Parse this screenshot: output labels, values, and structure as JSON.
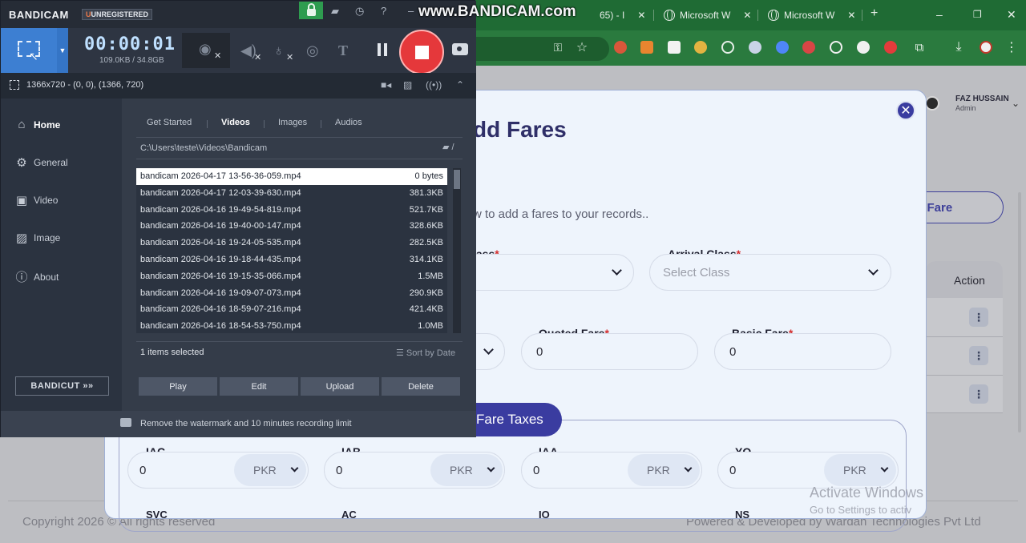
{
  "bandicam": {
    "brand": "BANDICAM",
    "unregistered": "UNREGISTERED",
    "watermark": "www.BANDICAM.com",
    "timer": "00:00:01",
    "sizes": "109.0KB / 34.8GB",
    "area": "1366x720 - (0, 0), (1366, 720)",
    "sidebar": [
      {
        "label": "Home",
        "icon": "home-icon",
        "active": true
      },
      {
        "label": "General",
        "icon": "gear-icon"
      },
      {
        "label": "Video",
        "icon": "video-icon"
      },
      {
        "label": "Image",
        "icon": "image-icon"
      },
      {
        "label": "About",
        "icon": "info-icon"
      }
    ],
    "bandicut": "BANDICUT",
    "tabs": [
      "Get Started",
      "Videos",
      "Images",
      "Audios"
    ],
    "active_tab": "Videos",
    "path": "C:\\Users\\teste\\Videos\\Bandicam",
    "files": [
      {
        "name": "bandicam 2026-04-17 13-56-36-059.mp4",
        "size": "0 bytes",
        "selected": true
      },
      {
        "name": "bandicam 2026-04-17 12-03-39-630.mp4",
        "size": "381.3KB"
      },
      {
        "name": "bandicam 2026-04-16 19-49-54-819.mp4",
        "size": "521.7KB"
      },
      {
        "name": "bandicam 2026-04-16 19-40-00-147.mp4",
        "size": "328.6KB"
      },
      {
        "name": "bandicam 2026-04-16 19-24-05-535.mp4",
        "size": "282.5KB"
      },
      {
        "name": "bandicam 2026-04-16 19-18-44-435.mp4",
        "size": "314.1KB"
      },
      {
        "name": "bandicam 2026-04-16 19-15-35-066.mp4",
        "size": "1.5MB"
      },
      {
        "name": "bandicam 2026-04-16 19-09-07-073.mp4",
        "size": "290.9KB"
      },
      {
        "name": "bandicam 2026-04-16 18-59-07-216.mp4",
        "size": "421.4KB"
      },
      {
        "name": "bandicam 2026-04-16 18-54-53-750.mp4",
        "size": "1.0MB"
      }
    ],
    "selection": "1 items selected",
    "sort": "Sort by Date",
    "actions": [
      "Play",
      "Edit",
      "Upload",
      "Delete"
    ],
    "footer": "Remove the watermark and 10 minutes recording limit"
  },
  "browser": {
    "tabs": [
      {
        "title": "65) - I"
      },
      {
        "title": "Microsoft W"
      },
      {
        "title": "Microsoft W"
      }
    ],
    "new_tab": "+",
    "window_controls": [
      "–",
      "❐",
      "✕"
    ]
  },
  "app": {
    "user": {
      "name": "FAZ HUSSAIN",
      "role": "Admin"
    },
    "add_fare_button": "ld Fare",
    "table": {
      "action_header": "Action"
    },
    "footer_left": "Copyright 2026 © All rights reserved",
    "footer_right": "Powered & Developed by Wardan Technologies Pvt Ltd"
  },
  "modal": {
    "title": "dd Fares",
    "subtitle": "w to add a fares to your records..",
    "departure_class_label": "lass",
    "arrival_class_label": "Arrival Class",
    "arrival_class_placeholder": "Select Class",
    "quoted_fare_label": "Quoted Fare",
    "quoted_fare_value": "0",
    "basic_fare_label": "Basic Fare",
    "basic_fare_value": "0",
    "required_mark": "*",
    "taxes_tab": "Fare Taxes",
    "taxes": [
      {
        "label": "IAC",
        "value": "0",
        "currency": "PKR"
      },
      {
        "label": "IAB",
        "value": "0",
        "currency": "PKR"
      },
      {
        "label": "IAA",
        "value": "0",
        "currency": "PKR"
      },
      {
        "label": "YQ",
        "value": "0",
        "currency": "PKR"
      }
    ],
    "taxes_row2": [
      "SVC",
      "AC",
      "IO",
      "NS"
    ]
  },
  "windows": {
    "activate_title": "Activate Windows",
    "activate_sub": "Go to Settings to activ"
  }
}
